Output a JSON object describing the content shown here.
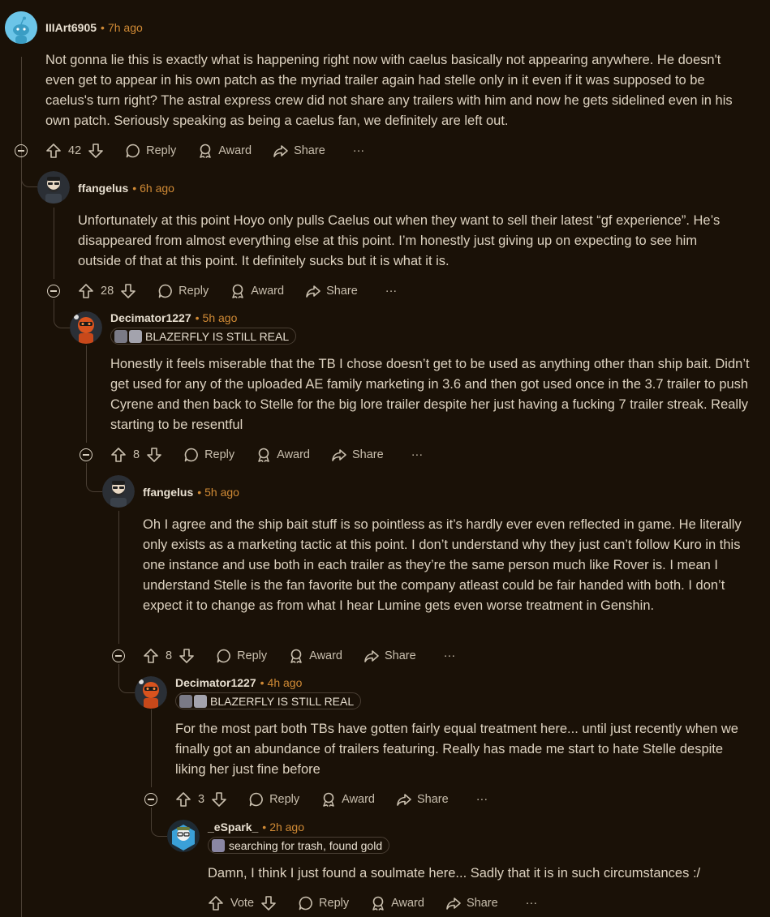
{
  "comments": [
    {
      "username": "IIIArt6905",
      "time": "7h ago",
      "body": "Not gonna lie this is exactly what is happening right now with caelus basically not appearing anywhere. He doesn't even get to appear in his own patch as the myriad trailer again had stelle only in it even if it was supposed to be caelus's turn right? The astral express crew did not share any trailers with him and now he gets sidelined even in his own patch. Seriously speaking as being a caelus fan, we definitely are left out.",
      "votes": "42"
    },
    {
      "username": "ffangelus",
      "time": "6h ago",
      "body": "Unfortunately at this point Hoyo only pulls Caelus out when they want to sell their latest “gf experience”. He’s disappeared from almost everything else at this point. I’m honestly just giving up on expecting to see him outside of that at this point. It definitely sucks but it is what it is.",
      "votes": "28"
    },
    {
      "username": "Decimator1227",
      "time": "5h ago",
      "flair": "BLAZERFLY IS STILL REAL",
      "body": "Honestly it feels miserable that the TB I chose doesn’t get to be used as anything other than ship bait. Didn’t get used for any of the uploaded AE family marketing in 3.6 and then got used once in the 3.7 trailer to push Cyrene and then back to Stelle for the big lore trailer despite her just having a fucking 7 trailer streak. Really starting to be resentful",
      "votes": "8"
    },
    {
      "username": "ffangelus",
      "time": "5h ago",
      "body": "Oh I agree and the ship bait stuff is so pointless as it’s hardly ever even reflected in game. He literally only exists as a marketing tactic at this point. I don’t understand why they just can’t follow Kuro in this one instance and use both in each trailer as they’re the same person much like Rover is. I mean I understand Stelle is the fan favorite but the company atleast could be fair handed with both. I don’t expect it to change as from what I hear Lumine gets even worse treatment in Genshin.",
      "votes": "8"
    },
    {
      "username": "Decimator1227",
      "time": "4h ago",
      "flair": "BLAZERFLY IS STILL REAL",
      "body": "For the most part both TBs have gotten fairly equal treatment here... until just recently when we finally got an abundance of trailers featuring. Really has made me start to hate Stelle despite liking her just fine before",
      "votes": "3"
    },
    {
      "username": "_eSpark_",
      "time": "2h ago",
      "flair": "searching for trash, found gold",
      "body": "Damn, I think I just found a soulmate here... Sadly that it is in such circumstances :/",
      "votes": "Vote"
    }
  ],
  "labels": {
    "reply": "Reply",
    "award": "Award",
    "share": "Share",
    "more": "···",
    "sep": "•"
  },
  "icons": [
    "upvote-icon",
    "downvote-icon",
    "reply-icon",
    "award-icon",
    "share-icon",
    "more-icon",
    "collapse-icon"
  ],
  "colors": {
    "background": "#1a1107",
    "text": "#ddd2c0",
    "timestamp": "#d08a35",
    "thread_line": "#4a3f34"
  }
}
